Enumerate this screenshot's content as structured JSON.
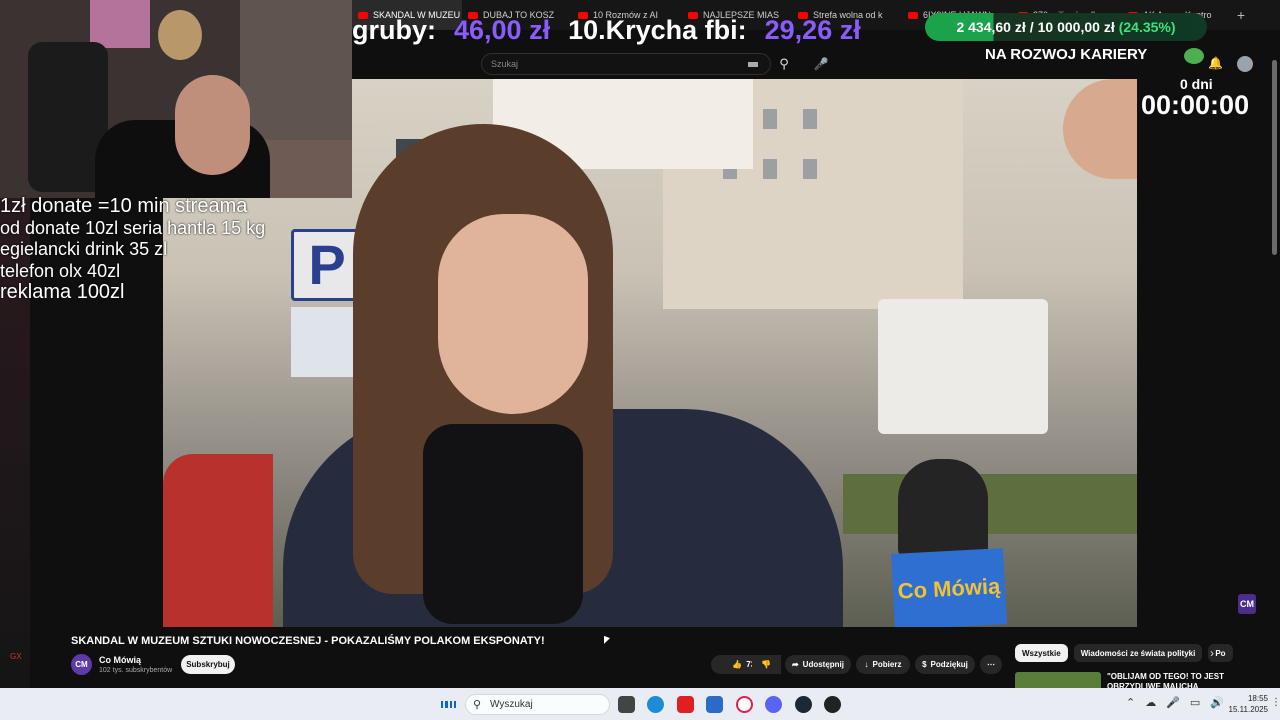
{
  "browser": {
    "tabs": [
      {
        "label": "SKANDAL W MUZEU",
        "active": true
      },
      {
        "label": "DUBAJ TO KOSZ"
      },
      {
        "label": "10 Rozmów z AI"
      },
      {
        "label": "NAJLEPSZE MIAS"
      },
      {
        "label": "Strefa wolna od k"
      },
      {
        "label": "6IX9INE UJAWN"
      },
      {
        "label": "270 milionów dla"
      },
      {
        "label": "AK AusserKontro"
      }
    ],
    "new_tab": "+"
  },
  "overlay": {
    "donate_label_1": "gruby:",
    "donate_value_1": "46,00 zł",
    "donate_label_2": "10.Krycha fbi:",
    "donate_value_2": "29,26 zł",
    "goal_current": "2 434,60 zł",
    "goal_sep": "/",
    "goal_target": "10 000,00 zł",
    "goal_percent": "(24.35%)",
    "goal_fraction": 0.2435,
    "goal_title": "NA ROZWOJ KARIERY",
    "timer_days": "0 dni",
    "timer": "00:00:00",
    "rules": [
      "1zł donate =10 min streama",
      "od donate 10zl seria hantla 15 kg",
      "egielancki drink 35 zl",
      "telefon olx 40zl",
      "reklama 100zl"
    ]
  },
  "youtube": {
    "search_placeholder": "Szukaj",
    "video_title": "SKANDAL W MUZEUM SZTUKI NOWOCZESNEJ - POKAZALIŚMY POLAKOM EKSPONATY!",
    "channel": {
      "avatar": "CM",
      "name": "Co Mówią",
      "subscribers": "102 tys. subskrybentów"
    },
    "subscribe_label": "Subskrybuj",
    "likes": "730",
    "share_label": "Udostępnij",
    "download_label": "Pobierz",
    "thanks_label": "Podziękuj",
    "chips": [
      "Wszystkie",
      "Wiadomości ze świata polityki",
      "Po"
    ],
    "reco_title": "\"OBLIJAM OD TEGO! TO JEST OBRZYDLIWE MAUCHA",
    "watermark": "CM",
    "sign_letter": "P",
    "mic_flag": "Co Mówią"
  },
  "taskbar": {
    "search_placeholder": "Wyszukaj",
    "time": "18:55",
    "date": "15.11.2025"
  },
  "colors": {
    "accent_purple": "#8a5cff",
    "goal_green": "#1aa34a",
    "yt_red": "#ff0000"
  }
}
